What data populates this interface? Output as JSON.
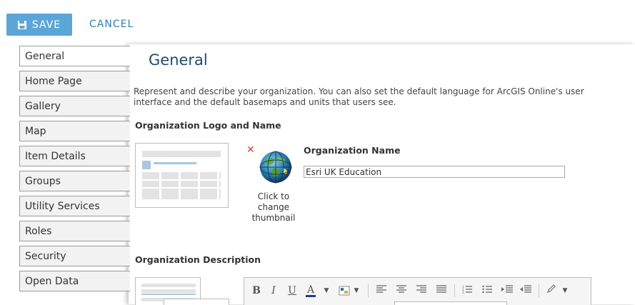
{
  "toolbar": {
    "save_label": "SAVE",
    "cancel_label": "CANCEL"
  },
  "sidebar": {
    "items": [
      {
        "label": "General",
        "active": true
      },
      {
        "label": "Home Page"
      },
      {
        "label": "Gallery"
      },
      {
        "label": "Map"
      },
      {
        "label": "Item Details"
      },
      {
        "label": "Groups"
      },
      {
        "label": "Utility Services"
      },
      {
        "label": "Roles"
      },
      {
        "label": "Security"
      },
      {
        "label": "Open Data"
      }
    ]
  },
  "main": {
    "title": "General",
    "intro": "Represent and describe your organization. You can also set the default language for ArcGIS Online's user interface and the default basemaps and units that users see.",
    "logo_section_title": "Organization Logo and Name",
    "thumbnail_caption": "Click to change thumbnail",
    "org_name_label": "Organization Name",
    "org_name_value": "Esri UK Education",
    "description_section_title": "Organization Description"
  },
  "editor": {
    "buttons": [
      "bold-icon",
      "italic-icon",
      "underline-icon",
      "font-color-icon",
      "highlight-icon",
      "align-left-icon",
      "align-center-icon",
      "align-right-icon",
      "justify-icon",
      "numbered-list-icon",
      "bullet-list-icon",
      "indent-icon",
      "outdent-icon",
      "pen-icon"
    ]
  },
  "colors": {
    "accent": "#5ba6d6",
    "title": "#1e4d6b",
    "link": "#2f7fb0",
    "remove": "#c9472b"
  }
}
